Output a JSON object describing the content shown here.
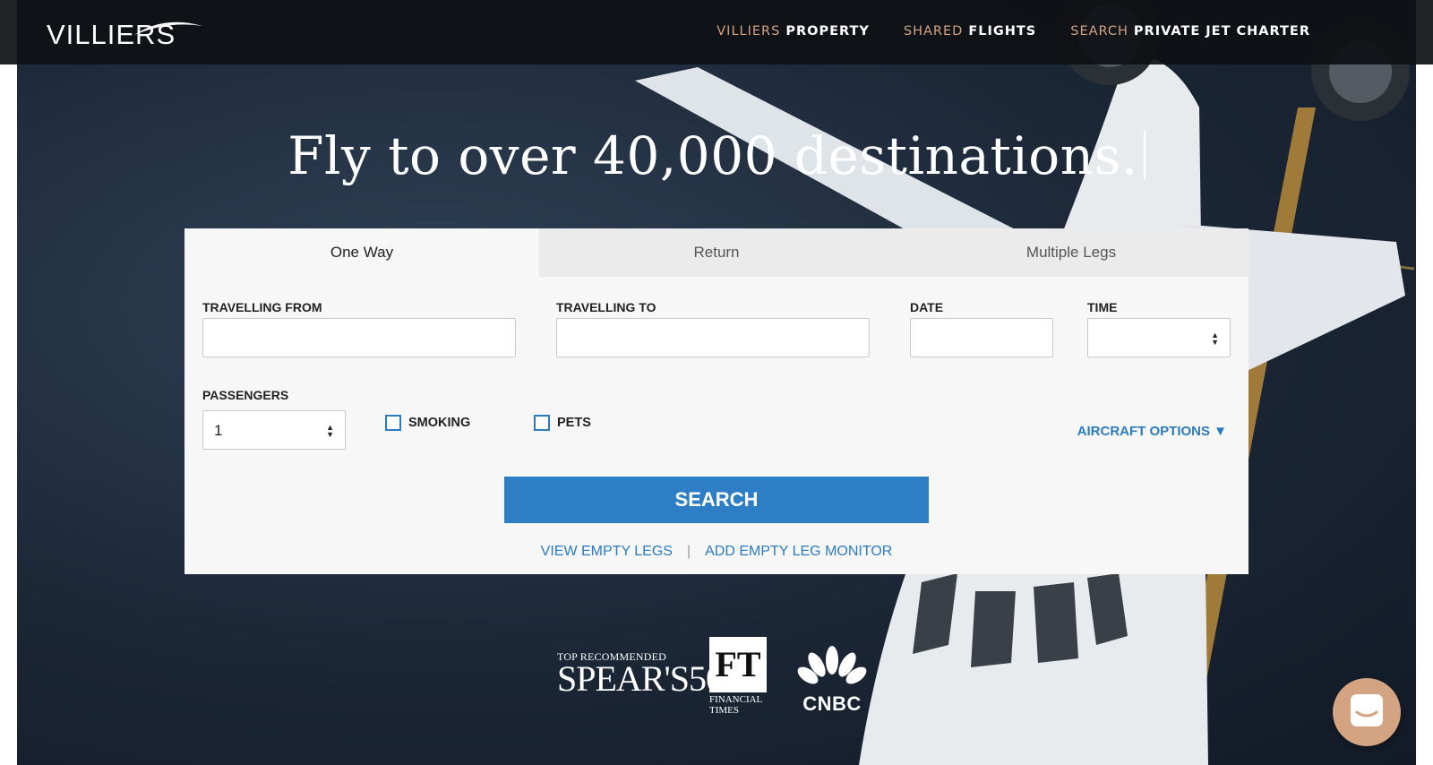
{
  "header": {
    "logo": "VILLIERS",
    "nav": [
      {
        "prefix": "VILLIERS",
        "label": "PROPERTY"
      },
      {
        "prefix": "SHARED",
        "label": "FLIGHTS"
      },
      {
        "prefix": "SEARCH",
        "label": "PRIVATE JET CHARTER"
      }
    ]
  },
  "hero": {
    "headline": "Fly to over 40,000 destinations."
  },
  "search": {
    "tabs": [
      "One Way",
      "Return",
      "Multiple Legs"
    ],
    "active_tab": "One Way",
    "labels": {
      "from": "TRAVELLING FROM",
      "to": "TRAVELLING TO",
      "date": "DATE",
      "time": "TIME",
      "passengers": "PASSENGERS"
    },
    "values": {
      "from": "",
      "to": "",
      "date": "",
      "time": "",
      "passengers": "1"
    },
    "options": {
      "smoking": "SMOKING",
      "pets": "PETS",
      "aircraft": "AIRCRAFT OPTIONS ▼"
    },
    "button": "SEARCH",
    "links": [
      "VIEW EMPTY LEGS",
      "ADD EMPTY LEG MONITOR"
    ],
    "separator": "|"
  },
  "press": {
    "spears_top": "TOP RECOMMENDED",
    "spears_big": "SPEAR'S500",
    "ft_logo": "FT",
    "ft_caption_1": "FINANCIAL",
    "ft_caption_2": "TIMES",
    "cnbc": "CNBC"
  },
  "colors": {
    "accent": "#d3a382",
    "link": "#2b7bc1",
    "button": "#2d7ec4",
    "header_bg": "#0e1014"
  },
  "icons": [
    "chat-icon",
    "stepper-icon",
    "checkbox-icon",
    "nbc-peacock-icon"
  ]
}
